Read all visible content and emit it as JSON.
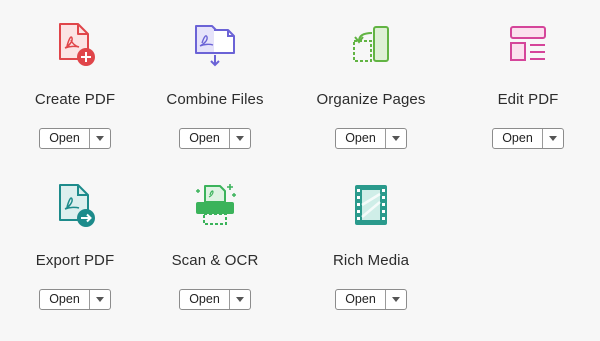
{
  "tools": [
    {
      "label": "Create PDF",
      "icon": "create-pdf-icon",
      "open_label": "Open",
      "color": "#e0454a"
    },
    {
      "label": "Combine Files",
      "icon": "combine-files-icon",
      "open_label": "Open",
      "color": "#6b63d6"
    },
    {
      "label": "Organize Pages",
      "icon": "organize-pages-icon",
      "open_label": "Open",
      "color": "#62b443"
    },
    {
      "label": "Edit PDF",
      "icon": "edit-pdf-icon",
      "open_label": "Open",
      "color": "#d5459a"
    },
    {
      "label": "Export PDF",
      "icon": "export-pdf-icon",
      "open_label": "Open",
      "color": "#1d8b8b"
    },
    {
      "label": "Scan & OCR",
      "icon": "scan-ocr-icon",
      "open_label": "Open",
      "color": "#3bb35b"
    },
    {
      "label": "Rich Media",
      "icon": "rich-media-icon",
      "open_label": "Open",
      "color": "#2a9a8c"
    }
  ]
}
